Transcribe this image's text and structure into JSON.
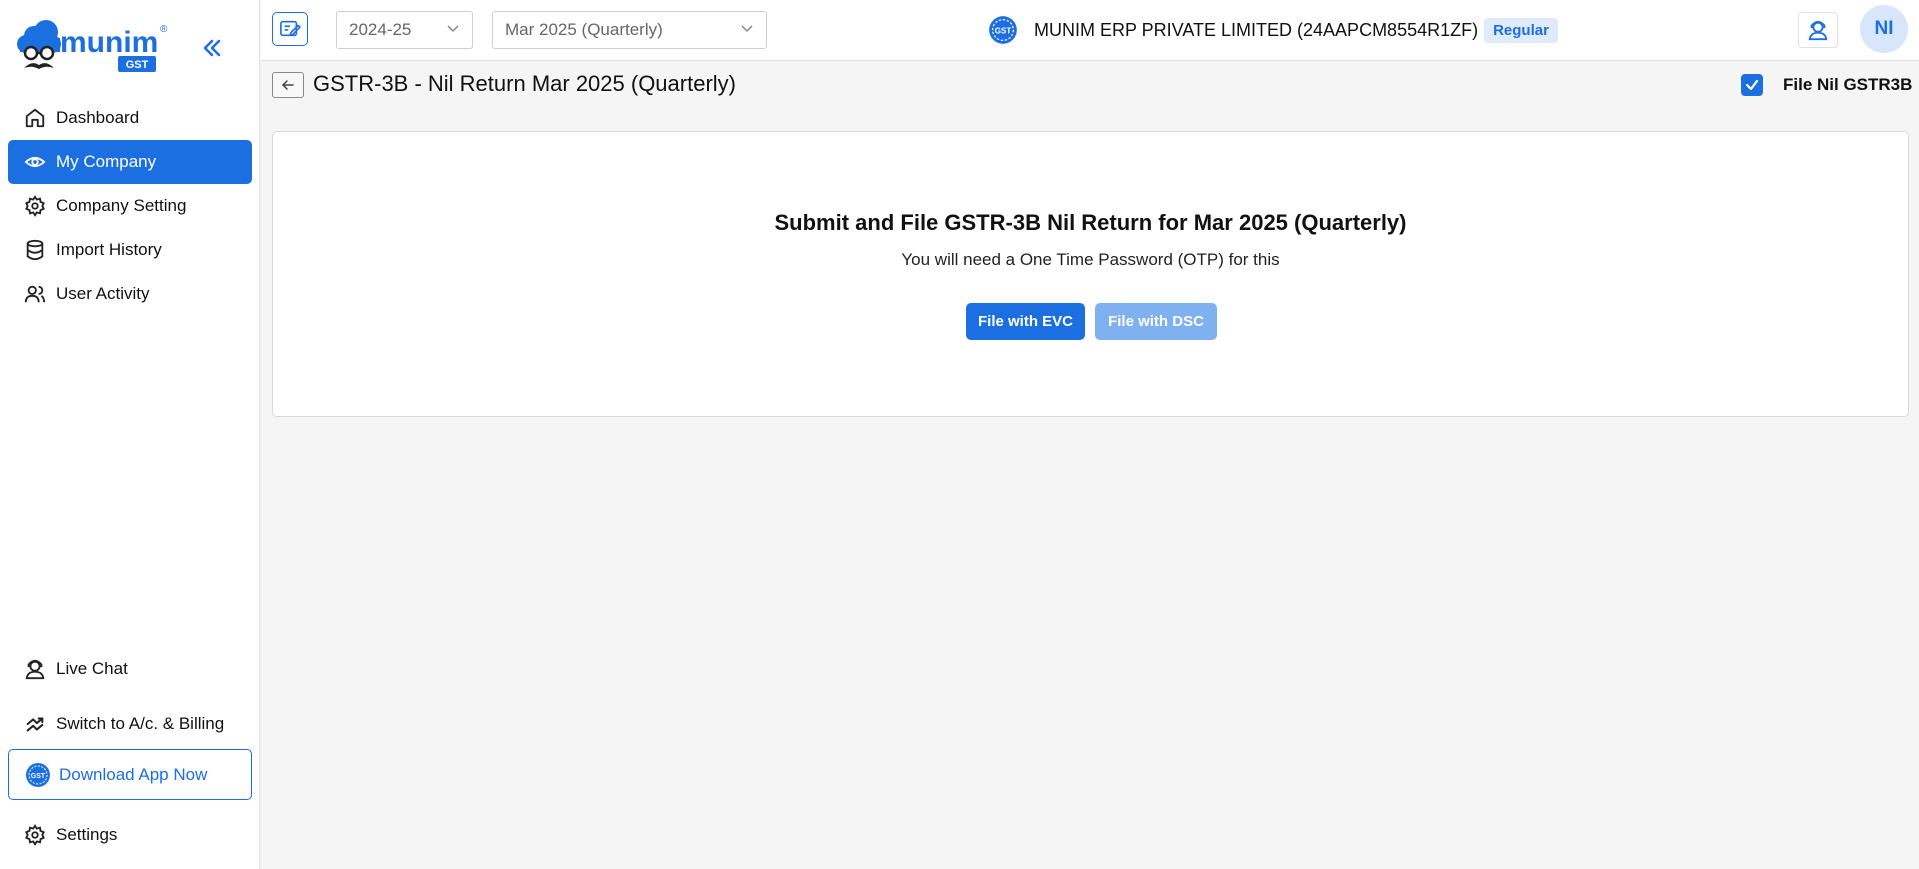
{
  "app": {
    "logo_text": "munim",
    "logo_sub": "GST",
    "logo_reg": "®"
  },
  "sidebar": {
    "items": [
      {
        "label": "Dashboard",
        "icon": "home-icon"
      },
      {
        "label": "My Company",
        "icon": "eye-icon",
        "active": true
      },
      {
        "label": "Company Setting",
        "icon": "gear-icon"
      },
      {
        "label": "Import History",
        "icon": "database-icon"
      },
      {
        "label": "User Activity",
        "icon": "users-icon"
      }
    ],
    "live_chat": "Live Chat",
    "switch": "Switch to A/c. & Billing",
    "download": "Download App Now",
    "settings": "Settings"
  },
  "topbar": {
    "year": "2024-25",
    "period": "Mar 2025 (Quarterly)",
    "company_name": "MUNIM ERP PRIVATE LIMITED (24AAPCM8554R1ZF)",
    "company_type": "Regular",
    "avatar_initials": "NI"
  },
  "page": {
    "title": "GSTR-3B - Nil Return Mar 2025 (Quarterly)",
    "nil_checkbox_label": "File Nil GSTR3B",
    "nil_checked": true
  },
  "card": {
    "title": "Submit and File GSTR-3B Nil Return for Mar 2025 (Quarterly)",
    "subtitle": "You will need a One Time Password (OTP) for this",
    "evc_button": "File with EVC",
    "dsc_button": "File with DSC"
  },
  "colors": {
    "accent": "#1c6fe0",
    "accent_light": "#7fb0ef",
    "badge_bg": "#dfeafb"
  }
}
